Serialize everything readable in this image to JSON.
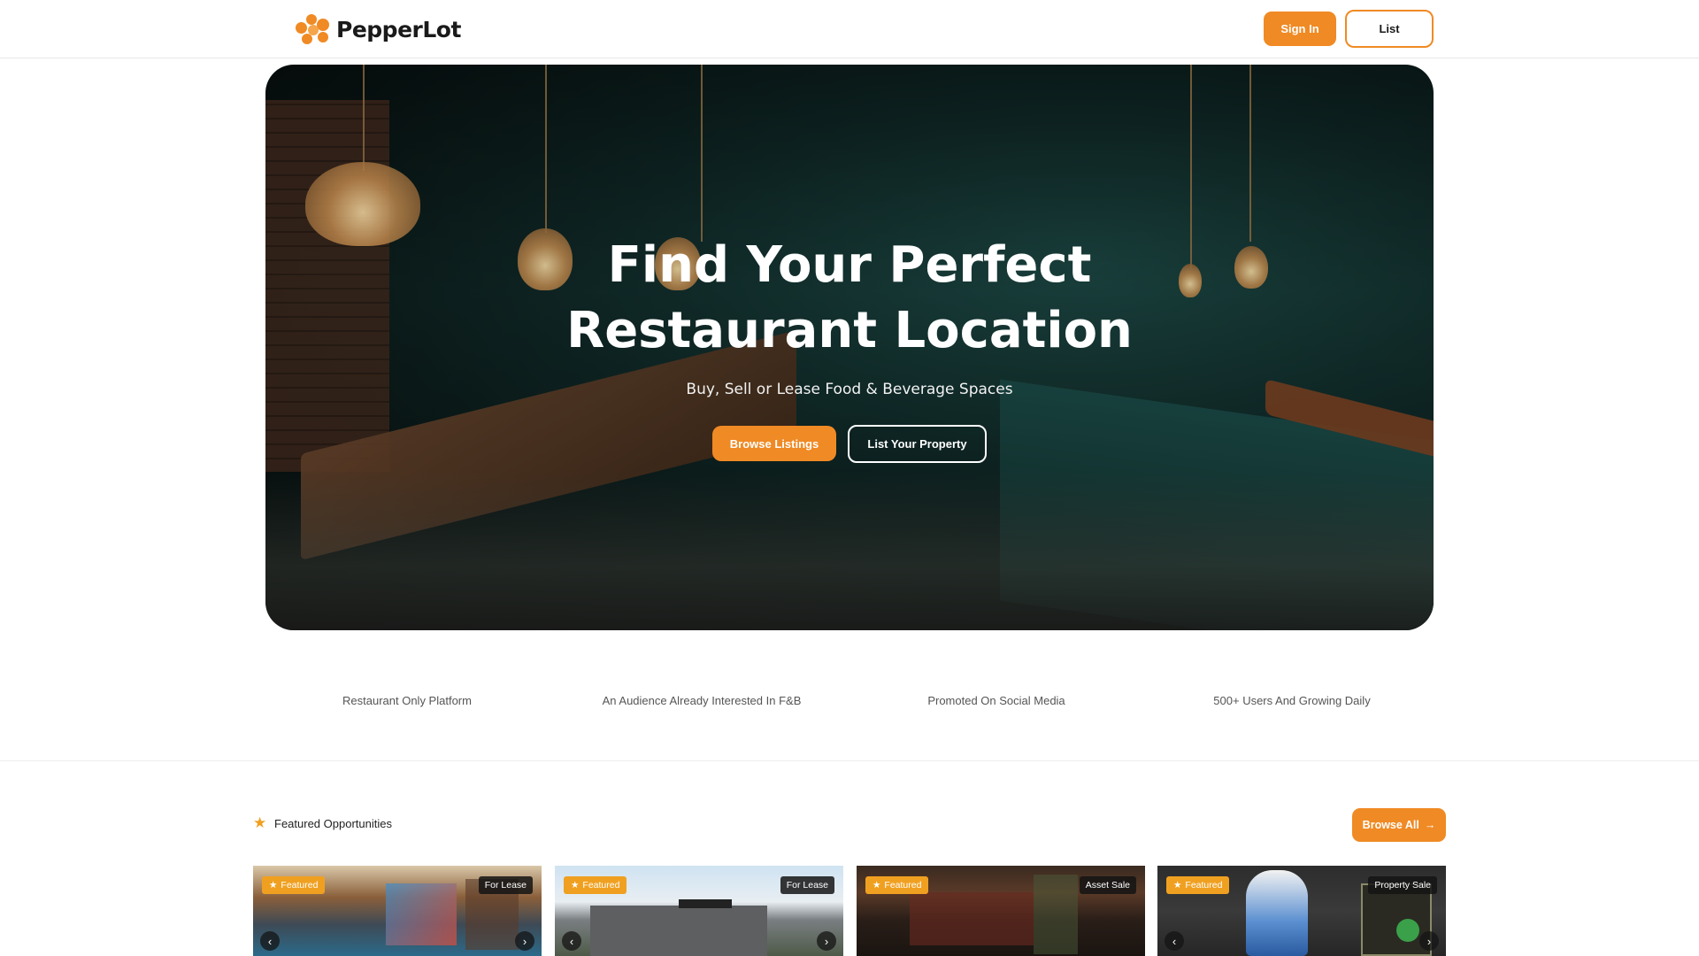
{
  "header": {
    "brand": "PepperLot",
    "signin_label": "Sign In",
    "list_label": "List"
  },
  "hero": {
    "title_line1": "Find Your Perfect",
    "title_line2": "Restaurant Location",
    "subtitle": "Buy, Sell or Lease Food & Beverage Spaces",
    "browse_label": "Browse Listings",
    "list_property_label": "List Your Property"
  },
  "features": [
    "Restaurant Only Platform",
    "An Audience Already Interested In F&B",
    "Promoted On Social Media",
    "500+ Users And Growing Daily"
  ],
  "featured": {
    "title": "Featured Opportunities",
    "browse_all_label": "Browse All",
    "badge_label": "Featured",
    "cards": [
      {
        "type": "For Lease"
      },
      {
        "type": "For Lease"
      },
      {
        "type": "Asset Sale"
      },
      {
        "type": "Property Sale"
      }
    ]
  },
  "colors": {
    "accent": "#f08a24",
    "badge": "#f0a020"
  },
  "icons": {
    "star": "star-icon",
    "arrow": "arrow-right-icon",
    "prev": "chevron-left-icon",
    "next": "chevron-right-icon"
  }
}
